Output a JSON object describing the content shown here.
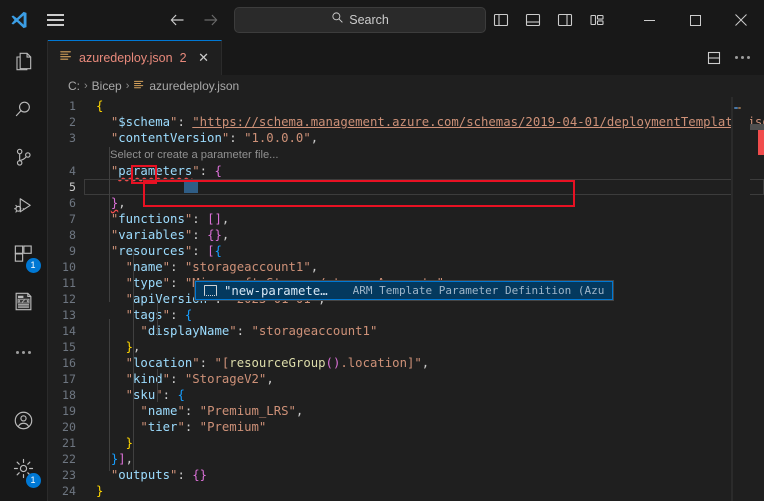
{
  "titlebar": {
    "logo_icon": "vscode-logo-icon",
    "menu_icon": "hamburger-menu-icon",
    "back_icon": "arrow-left-icon",
    "forward_icon": "arrow-right-icon",
    "search": {
      "placeholder": "Search",
      "icon": "search-icon"
    },
    "layout_buttons": [
      {
        "name": "toggle-primary-sidebar",
        "icon": "layout-sidebar-left-icon"
      },
      {
        "name": "toggle-panel",
        "icon": "layout-panel-icon"
      },
      {
        "name": "toggle-secondary-sidebar",
        "icon": "layout-sidebar-right-icon"
      },
      {
        "name": "customize-layout",
        "icon": "layout-customize-icon"
      }
    ],
    "window_buttons": [
      {
        "name": "minimize-window",
        "glyph": "–"
      },
      {
        "name": "maximize-window",
        "glyph": "□"
      },
      {
        "name": "close-window",
        "glyph": "✕"
      }
    ]
  },
  "activitybar": {
    "items": [
      {
        "name": "explorer",
        "icon": "files-icon",
        "badge": ""
      },
      {
        "name": "search",
        "icon": "search-icon",
        "badge": ""
      },
      {
        "name": "source-control",
        "icon": "source-control-icon",
        "badge": ""
      },
      {
        "name": "run-and-debug",
        "icon": "run-debug-icon",
        "badge": ""
      },
      {
        "name": "extensions",
        "icon": "extensions-icon",
        "badge": "1"
      },
      {
        "name": "azure-resource-manager-tools",
        "icon": "arm-template-icon",
        "badge": ""
      },
      {
        "name": "additional-views",
        "icon": "ellipsis-icon",
        "badge": ""
      }
    ],
    "bottom_items": [
      {
        "name": "accounts",
        "icon": "account-icon",
        "badge": ""
      },
      {
        "name": "manage-settings",
        "icon": "gear-icon",
        "badge": "1"
      }
    ]
  },
  "editor": {
    "tab": {
      "icon": "json-file-icon",
      "label": "azuredeploy.json",
      "error_count": "2",
      "close_glyph": "✕"
    },
    "tab_actions": [
      {
        "name": "split-editor-down",
        "icon": "split-editor-down-icon"
      },
      {
        "name": "more-editor-actions",
        "icon": "ellipsis-icon"
      }
    ],
    "breadcrumb": {
      "items": [
        "C:",
        "Bicep",
        "azuredeploy.json"
      ],
      "separator": "›",
      "file_icon": "json-file-icon"
    },
    "codelens": {
      "line": 4,
      "text": "Select or create a parameter file..."
    },
    "lines": [
      {
        "n": "1",
        "text": "{"
      },
      {
        "n": "2",
        "text": "    \"$schema\": \"https://schema.management.azure.com/schemas/2019-04-01/deploymentTemplate.json#\","
      },
      {
        "n": "3",
        "text": "    \"contentVersion\": \"1.0.0.0\","
      },
      {
        "n": "4",
        "text": "    \"parameters\": {"
      },
      {
        "n": "5",
        "text": ""
      },
      {
        "n": "6",
        "text": "    },"
      },
      {
        "n": "7",
        "text": "    \"functions\": [],"
      },
      {
        "n": "8",
        "text": "    \"variables\": {},"
      },
      {
        "n": "9",
        "text": "    \"resources\": [{"
      },
      {
        "n": "10",
        "text": "        \"name\": \"storageaccount1\","
      },
      {
        "n": "11",
        "text": "        \"type\": \"Microsoft.Storage/storageAccounts\","
      },
      {
        "n": "12",
        "text": "        \"apiVersion\": \"2023-01-01\","
      },
      {
        "n": "13",
        "text": "        \"tags\": {"
      },
      {
        "n": "14",
        "text": "            \"displayName\": \"storageaccount1\""
      },
      {
        "n": "15",
        "text": "        },"
      },
      {
        "n": "16",
        "text": "        \"location\": \"[resourceGroup().location]\","
      },
      {
        "n": "17",
        "text": "        \"kind\": \"StorageV2\","
      },
      {
        "n": "18",
        "text": "        \"sku\": {"
      },
      {
        "n": "19",
        "text": "            \"name\": \"Premium_LRS\","
      },
      {
        "n": "20",
        "text": "            \"tier\": \"Premium\""
      },
      {
        "n": "21",
        "text": "        }"
      },
      {
        "n": "22",
        "text": "    }],"
      },
      {
        "n": "23",
        "text": "    \"outputs\": {}"
      },
      {
        "n": "24",
        "text": "}"
      }
    ],
    "suggest_widget": {
      "icon": "snippet-field-icon",
      "label": "\"new-paramete…",
      "detail": "ARM Template Parameter Definition (Azure Resource…"
    }
  },
  "colors": {
    "accent": "#0078d4",
    "error": "#f14c4c",
    "annotation": "#e81123",
    "editor_bg": "#1f1f1f",
    "chrome_bg": "#181818",
    "string": "#ce9178",
    "key": "#9cdcfe",
    "selected_suggest_bg": "#04395e"
  }
}
